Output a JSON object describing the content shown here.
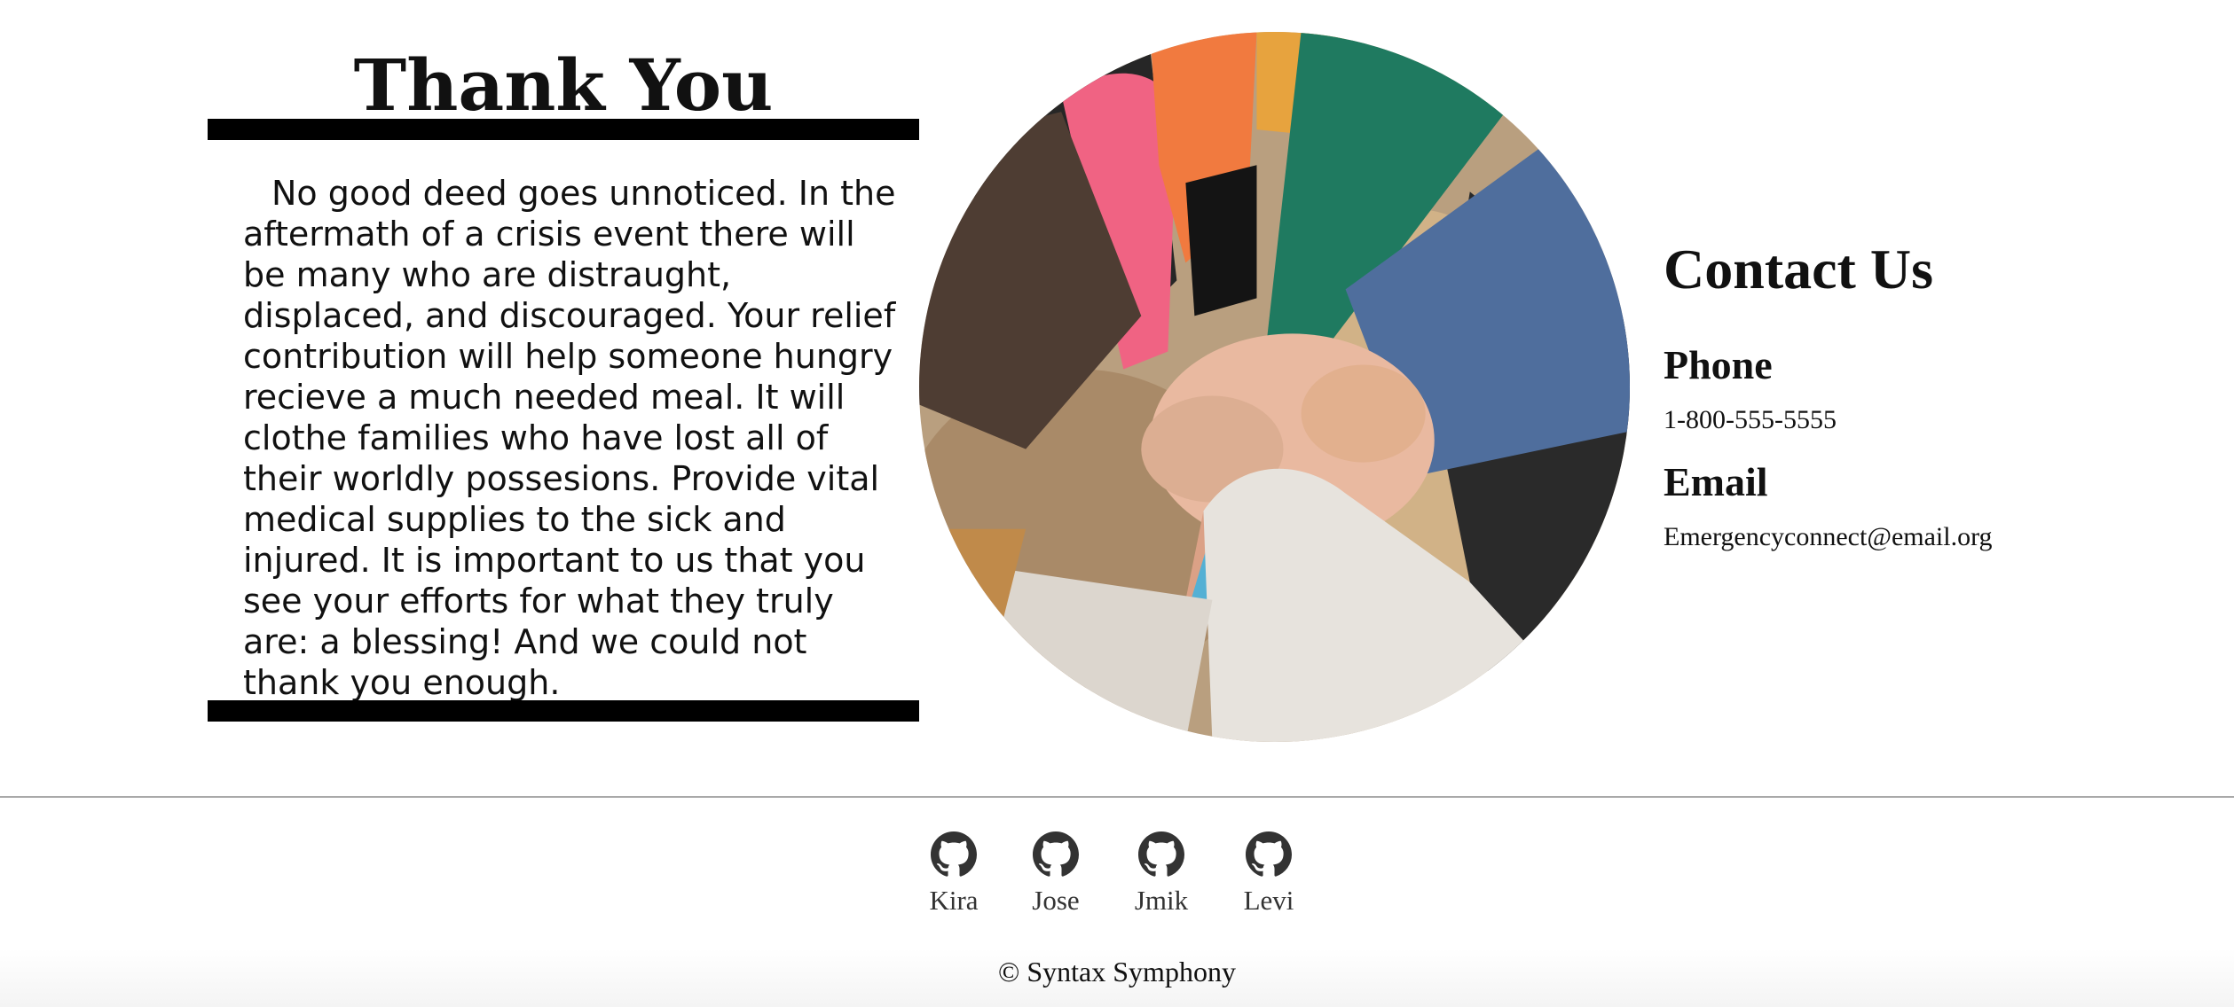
{
  "thank_you": {
    "title": "Thank You",
    "body": "No good deed goes unnoticed. In the aftermath of a crisis event there will be many who are distraught, displaced, and discouraged. Your relief contribution will help someone hungry recieve a much needed meal. It will clothe families who have lost all of their worldly possesions. Provide vital medical supplies to the sick and injured. It is important to us that you see your efforts for what they truly are: a blessing! And we could not thank you enough."
  },
  "contact": {
    "title": "Contact Us",
    "phone_heading": "Phone",
    "phone": "1-800-555-5555",
    "email_heading": "Email",
    "email": "Emergencyconnect@email.org"
  },
  "team": [
    {
      "name": "Kira",
      "icon": "github-icon"
    },
    {
      "name": "Jose",
      "icon": "github-icon"
    },
    {
      "name": "Jmik",
      "icon": "github-icon"
    },
    {
      "name": "Levi",
      "icon": "github-icon"
    }
  ],
  "footer": {
    "copyright": "© Syntax Symphony"
  },
  "colors": {
    "bar": "#000000",
    "divider": "#a9a9a9",
    "icon": "#333333"
  }
}
